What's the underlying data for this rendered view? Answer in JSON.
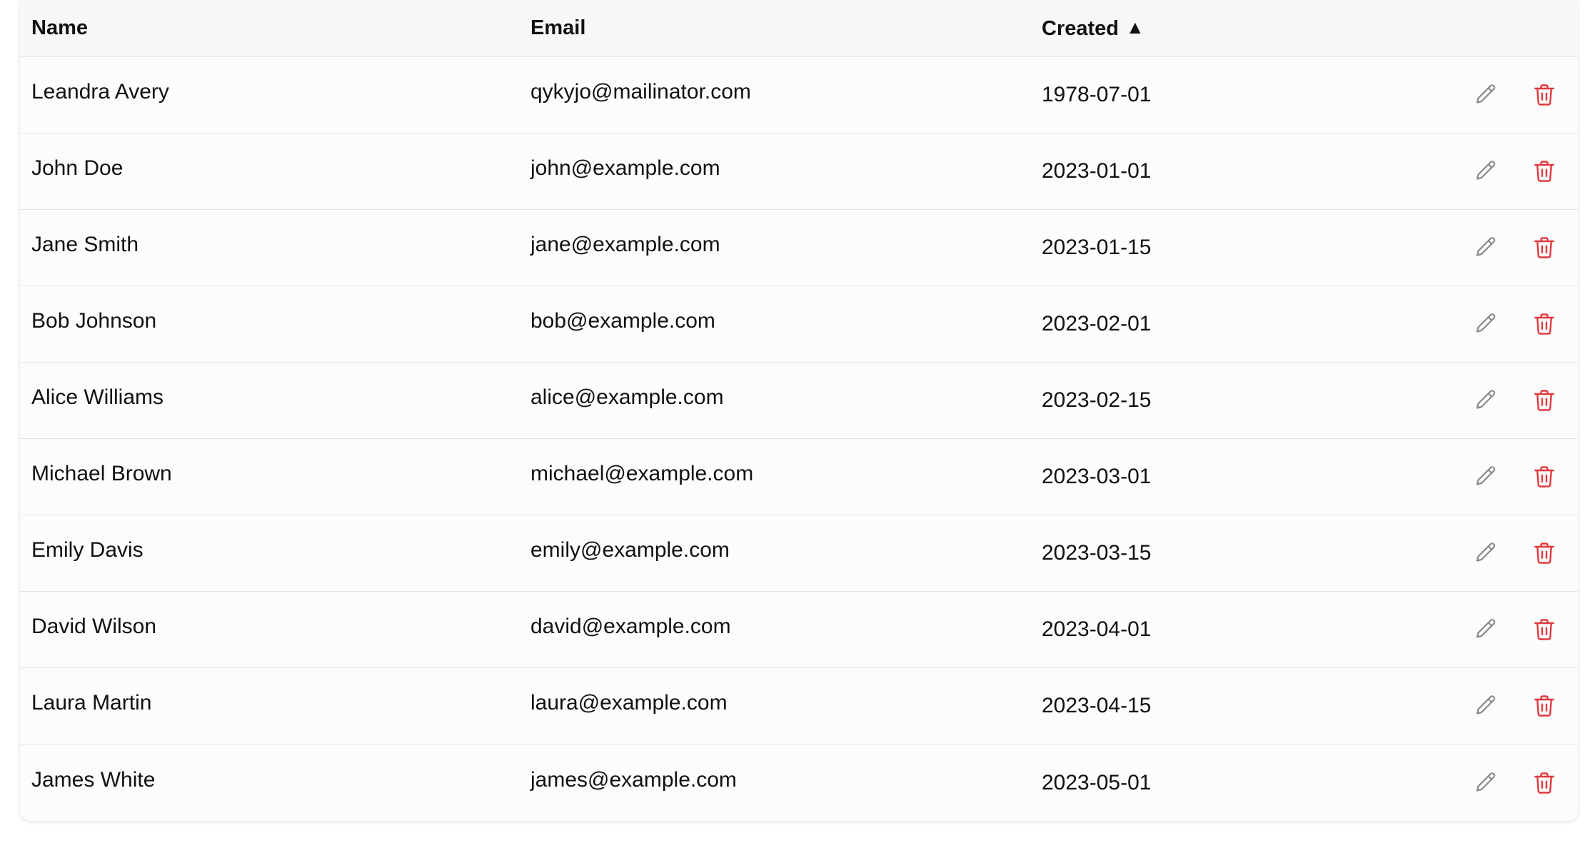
{
  "table": {
    "columns": {
      "name": "Name",
      "email": "Email",
      "created": "Created",
      "created_sort": "▲"
    },
    "rows": [
      {
        "name": "Leandra Avery",
        "email": "qykyjo@mailinator.com",
        "created": "1978-07-01"
      },
      {
        "name": "John Doe",
        "email": "john@example.com",
        "created": "2023-01-01"
      },
      {
        "name": "Jane Smith",
        "email": "jane@example.com",
        "created": "2023-01-15"
      },
      {
        "name": "Bob Johnson",
        "email": "bob@example.com",
        "created": "2023-02-01"
      },
      {
        "name": "Alice Williams",
        "email": "alice@example.com",
        "created": "2023-02-15"
      },
      {
        "name": "Michael Brown",
        "email": "michael@example.com",
        "created": "2023-03-01"
      },
      {
        "name": "Emily Davis",
        "email": "emily@example.com",
        "created": "2023-03-15"
      },
      {
        "name": "David Wilson",
        "email": "david@example.com",
        "created": "2023-04-01"
      },
      {
        "name": "Laura Martin",
        "email": "laura@example.com",
        "created": "2023-04-15"
      },
      {
        "name": "James White",
        "email": "james@example.com",
        "created": "2023-05-01"
      }
    ],
    "icons": {
      "edit": "pencil-icon",
      "delete": "trash-icon"
    },
    "colors": {
      "edit_icon": "#8a8a8a",
      "delete_icon": "#e0393e",
      "header_bg": "#f7f7f7",
      "row_bg": "#fcfcfc"
    }
  }
}
